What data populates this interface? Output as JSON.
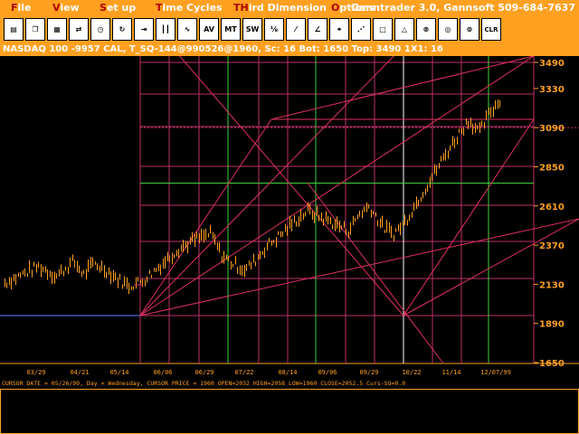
{
  "menu": {
    "items": [
      {
        "hot": "F",
        "rest": "ile"
      },
      {
        "hot": "V",
        "rest": "iew"
      },
      {
        "hot": "S",
        "rest": "et up"
      },
      {
        "hot": "T",
        "rest": "ime Cycles"
      },
      {
        "hot": "TH",
        "rest": "ird Dimension"
      },
      {
        "hot": "O",
        "rest": "ptions"
      }
    ],
    "app_title": "Ganntrader 3.0, Gannsoft 509-684-7637"
  },
  "toolbar": {
    "buttons": [
      {
        "icon": "printer-icon",
        "glyph": "▤"
      },
      {
        "icon": "copy-icon",
        "glyph": "❐"
      },
      {
        "icon": "grid-icon",
        "glyph": "▦"
      },
      {
        "icon": "arrows-icon",
        "glyph": "⇄"
      },
      {
        "icon": "clock-icon",
        "glyph": "◷"
      },
      {
        "icon": "rotate-icon",
        "glyph": "↻"
      },
      {
        "icon": "range-icon",
        "glyph": "⇥"
      },
      {
        "icon": "bars-icon",
        "glyph": "┃┃"
      },
      {
        "icon": "wave-icon",
        "glyph": "∿"
      },
      {
        "icon": "av-icon",
        "glyph": "AV"
      },
      {
        "icon": "mt-icon",
        "glyph": "MT"
      },
      {
        "icon": "sw-icon",
        "glyph": "SW"
      },
      {
        "icon": "fraction-icon",
        "glyph": "⅛"
      },
      {
        "icon": "slash-icon",
        "glyph": "⁄"
      },
      {
        "icon": "angle-icon",
        "glyph": "∠"
      },
      {
        "icon": "crosshair-icon",
        "glyph": "⌖"
      },
      {
        "icon": "fan-icon",
        "glyph": "⋰"
      },
      {
        "icon": "square-icon",
        "glyph": "□"
      },
      {
        "icon": "triangle-icon",
        "glyph": "△"
      },
      {
        "icon": "circle-cross-icon",
        "glyph": "⊗"
      },
      {
        "icon": "target-icon",
        "glyph": "◎"
      },
      {
        "icon": "spiral-icon",
        "glyph": "⊚"
      },
      {
        "icon": "clear-icon",
        "glyph": "CLR"
      }
    ]
  },
  "info_bar": "NASDAQ 100 -9957 CAL, T_SQ-144@990526@1960, Sc: 16 Bot: 1650 Top: 3490 1X1: 16",
  "chart_data": {
    "type": "bar",
    "symbol": "NASDAQ 100",
    "ylim": [
      1650,
      3490
    ],
    "y_ticks": [
      "3490",
      "3330",
      "3090",
      "2850",
      "2610",
      "2370",
      "2130",
      "1890",
      "1650"
    ],
    "x_ticks": [
      "03/29",
      "04/21",
      "05/14",
      "06/06",
      "06/29",
      "07/22",
      "08/14",
      "09/06",
      "09/29",
      "10/22",
      "11/14",
      "12/07/99"
    ],
    "bot": 1650,
    "top": 3490,
    "square_start": "05/26/99",
    "square_start_price": 1960,
    "resistance_level": 3090,
    "green_level": 2750,
    "price_path": [
      {
        "x": 1,
        "y": 2140
      },
      {
        "x": 2,
        "y": 2240
      },
      {
        "x": 2.5,
        "y": 2180
      },
      {
        "x": 3,
        "y": 2270
      },
      {
        "x": 3.3,
        "y": 2190
      },
      {
        "x": 3.6,
        "y": 2260
      },
      {
        "x": 4,
        "y": 2210
      },
      {
        "x": 4.3,
        "y": 2160
      },
      {
        "x": 4.6,
        "y": 2120
      },
      {
        "x": 5,
        "y": 2150
      },
      {
        "x": 5.5,
        "y": 2240
      },
      {
        "x": 6,
        "y": 2340
      },
      {
        "x": 6.5,
        "y": 2400
      },
      {
        "x": 7,
        "y": 2440
      },
      {
        "x": 7.3,
        "y": 2310
      },
      {
        "x": 7.6,
        "y": 2260
      },
      {
        "x": 8,
        "y": 2220
      },
      {
        "x": 8.3,
        "y": 2280
      },
      {
        "x": 8.6,
        "y": 2360
      },
      {
        "x": 9,
        "y": 2430
      },
      {
        "x": 9.4,
        "y": 2510
      },
      {
        "x": 9.8,
        "y": 2580
      },
      {
        "x": 10.2,
        "y": 2540
      },
      {
        "x": 10.6,
        "y": 2500
      },
      {
        "x": 11,
        "y": 2460
      },
      {
        "x": 11.3,
        "y": 2560
      },
      {
        "x": 11.6,
        "y": 2610
      },
      {
        "x": 12,
        "y": 2480
      },
      {
        "x": 12.3,
        "y": 2440
      },
      {
        "x": 12.6,
        "y": 2500
      },
      {
        "x": 13,
        "y": 2640
      },
      {
        "x": 13.4,
        "y": 2780
      },
      {
        "x": 13.8,
        "y": 2920
      },
      {
        "x": 14.2,
        "y": 3050
      },
      {
        "x": 14.5,
        "y": 3140
      },
      {
        "x": 14.8,
        "y": 3060
      },
      {
        "x": 15.1,
        "y": 3180
      },
      {
        "x": 15.4,
        "y": 3260
      }
    ]
  },
  "cursor_info": "CURSOR DATE = 05/26/99, Day = Wednesday, CURSOR PRICE = 1960 OPEN=2032 HIGH=2058 LOW=1960 CLOSE=2052.5 Curs-SQ=0.0"
}
